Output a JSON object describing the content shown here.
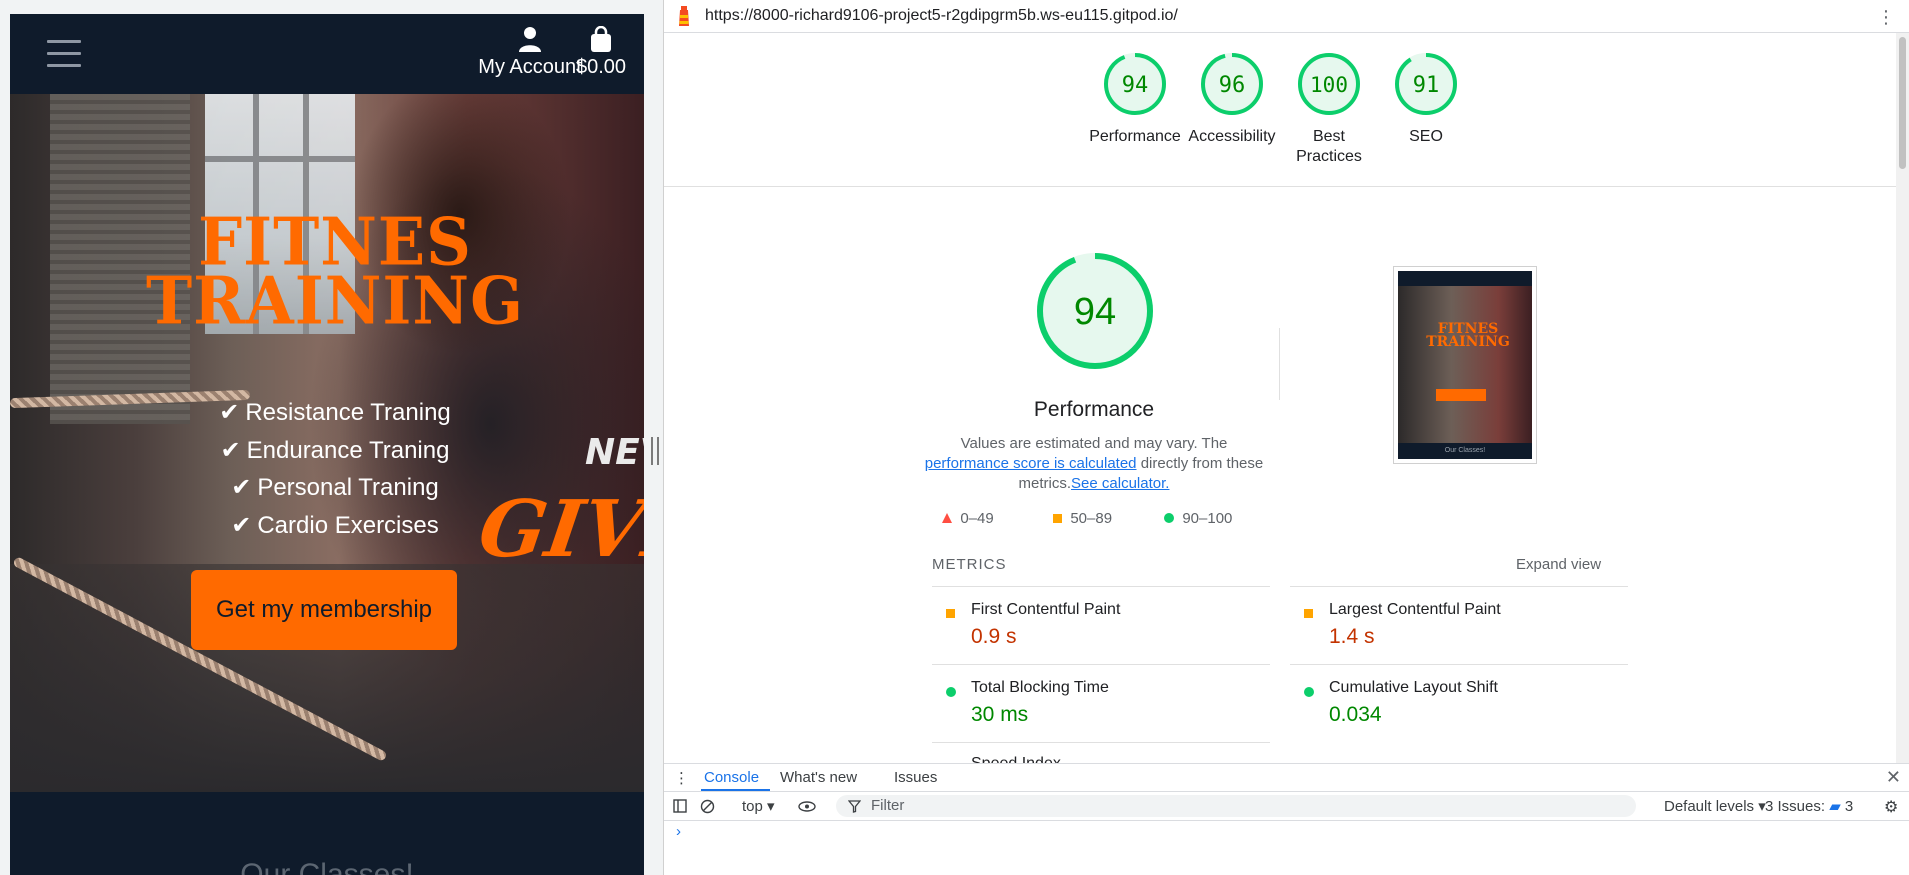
{
  "device": {
    "nav": {
      "account_label": "My Account",
      "bag_label": "$0.00"
    },
    "hero": {
      "title_line1": "FITNES",
      "title_line2": "TRAINING",
      "list": [
        "Resistance Traning",
        "Endurance Traning",
        "Personal Traning",
        "Cardio Exercises"
      ],
      "cta_label": "Get my membership",
      "never_text": "NEVE",
      "give_text": "GIVE"
    },
    "section_heading": "Our Classes!"
  },
  "devtools": {
    "url": "https://8000-richard9106-project5-r2gdipgrm5b.ws-eu115.gitpod.io/",
    "scores": [
      {
        "label": "Performance",
        "value": 94
      },
      {
        "label": "Accessibility",
        "value": 96
      },
      {
        "label": "Best Practices",
        "value": 100
      },
      {
        "label": "SEO",
        "value": 91
      }
    ],
    "performance": {
      "score": 94,
      "title": "Performance",
      "desc_part1": "Values are estimated and may vary. The",
      "link_calc": "performance score is calculated",
      "desc_part2": "directly from these metrics.",
      "link_see": "See calculator."
    },
    "thumbnail_footer": "Our Classes!",
    "legend": {
      "fail": "0–49",
      "average": "50–89",
      "pass": "90–100"
    },
    "metrics_heading": "METRICS",
    "expand_view": "Expand view",
    "metrics": [
      {
        "name": "First Contentful Paint",
        "value": "0.9 s",
        "rating": "average"
      },
      {
        "name": "Largest Contentful Paint",
        "value": "1.4 s",
        "rating": "average"
      },
      {
        "name": "Total Blocking Time",
        "value": "30 ms",
        "rating": "pass"
      },
      {
        "name": "Cumulative Layout Shift",
        "value": "0.034",
        "rating": "pass"
      },
      {
        "name": "Speed Index",
        "value": "",
        "rating": "pass"
      }
    ],
    "drawer": {
      "tabs": [
        "Console",
        "What's new",
        "Issues"
      ],
      "context": "top",
      "filter_placeholder": "Filter",
      "levels": "Default levels",
      "issues_label": "3 Issues:",
      "issues_count": "3"
    }
  },
  "colors": {
    "brand_orange": "#ff6a00",
    "nav_bg": "#0f1b2b",
    "pass_green": "#0cce6b",
    "average_orange": "#ffa400",
    "link_blue": "#1a73e8"
  }
}
